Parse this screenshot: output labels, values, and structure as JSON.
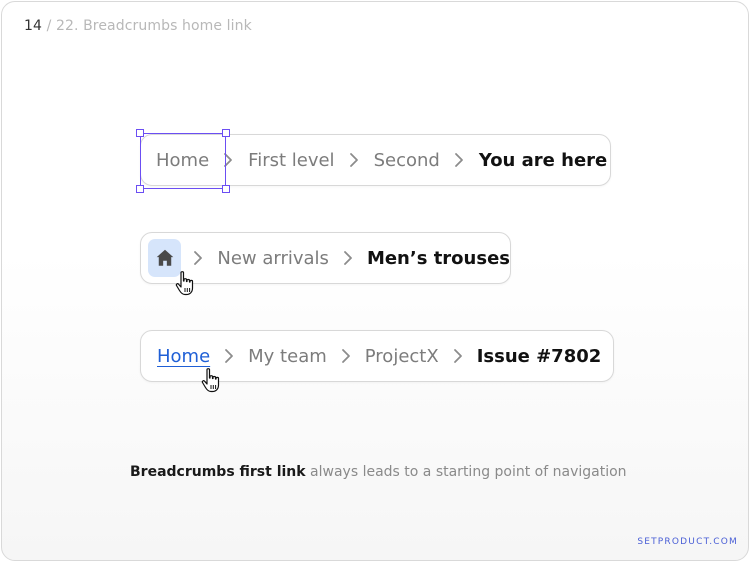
{
  "header": {
    "page_number": "14",
    "separator": "/",
    "section_title": "22. Breadcrumbs home link"
  },
  "example_1": {
    "items": [
      "Home",
      "First level",
      "Second"
    ],
    "current": "You are here"
  },
  "example_2": {
    "home_icon": "home-icon",
    "items": [
      "New arrivals"
    ],
    "current": "Men’s trouses"
  },
  "example_3": {
    "home_link": "Home",
    "items": [
      "My team",
      "ProjectX"
    ],
    "current": "Issue #7802"
  },
  "caption": {
    "bold": "Breadcrumbs first link",
    "rest": "always leads to a starting point of navigation"
  },
  "brand": "SETPRODUCT.COM",
  "colors": {
    "selection": "#6b4ef3",
    "link": "#1f5fd6",
    "home_button_bg": "#d6e5fb",
    "brand": "#4a5fd6"
  }
}
